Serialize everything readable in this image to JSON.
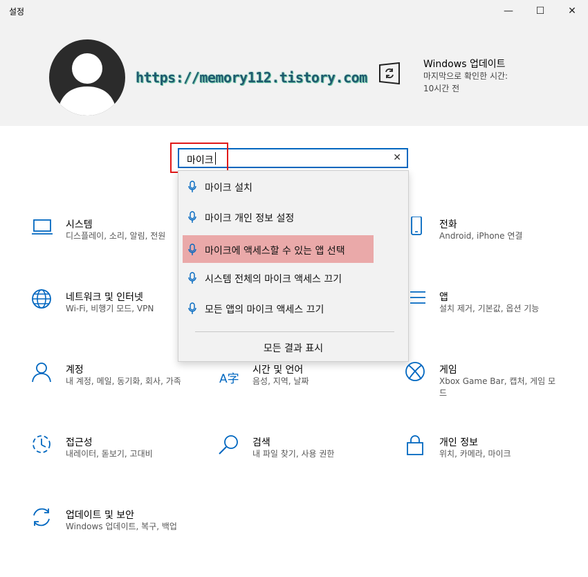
{
  "window": {
    "title": "설정",
    "minimize": "—",
    "maximize": "☐",
    "close": "✕"
  },
  "header": {
    "watermark": "https://memory112.tistory.com",
    "windows_update": {
      "title": "Windows 업데이트",
      "subtitle": "마지막으로 확인한 시간: 10시간 전"
    }
  },
  "search": {
    "value": "마이크",
    "clear": "✕",
    "suggestions": [
      {
        "label": "마이크 설치",
        "icon": "microphone-icon"
      },
      {
        "label": "마이크 개인 정보 설정",
        "icon": "microphone-icon"
      },
      {
        "label": "마이크에 액세스할 수 있는 앱 선택",
        "icon": "microphone-icon",
        "highlighted": true
      },
      {
        "label": "시스템 전체의 마이크 액세스 끄기",
        "icon": "microphone-icon"
      },
      {
        "label": "모든 앱의 마이크 액세스 끄기",
        "icon": "microphone-icon"
      }
    ],
    "show_all": "모든 결과 표시"
  },
  "categories": [
    {
      "title": "시스템",
      "desc": "디스플레이, 소리, 알림, 전원",
      "icon": "laptop-icon"
    },
    {
      "title": "전화",
      "desc": "Android, iPhone 연결",
      "icon": "phone-icon"
    },
    {
      "title": "네트워크 및 인터넷",
      "desc": "Wi-Fi, 비행기 모드, VPN",
      "icon": "globe-icon"
    },
    {
      "title": "앱",
      "desc": "설치 제거, 기본값, 옵션 기능",
      "icon": "apps-list-icon"
    },
    {
      "title": "계정",
      "desc": "내 계정, 메일, 동기화, 회사, 가족",
      "icon": "person-icon"
    },
    {
      "title": "시간 및 언어",
      "desc": "음성, 지역, 날짜",
      "icon": "time-language-icon"
    },
    {
      "title": "게임",
      "desc": "Xbox Game Bar, 캡처, 게임 모드",
      "icon": "xbox-icon"
    },
    {
      "title": "접근성",
      "desc": "내레이터, 돋보기, 고대비",
      "icon": "ease-of-access-icon"
    },
    {
      "title": "검색",
      "desc": "내 파일 찾기, 사용 권한",
      "icon": "search-icon"
    },
    {
      "title": "개인 정보",
      "desc": "위치, 카메라, 마이크",
      "icon": "lock-icon"
    },
    {
      "title": "업데이트 및 보안",
      "desc": "Windows 업데이트, 복구, 백업",
      "icon": "sync-icon"
    }
  ],
  "colors": {
    "accent": "#0067c0",
    "header_bg": "#f2f2f2",
    "highlight": "#eaa9a9",
    "annotation_red": "#e01818"
  }
}
